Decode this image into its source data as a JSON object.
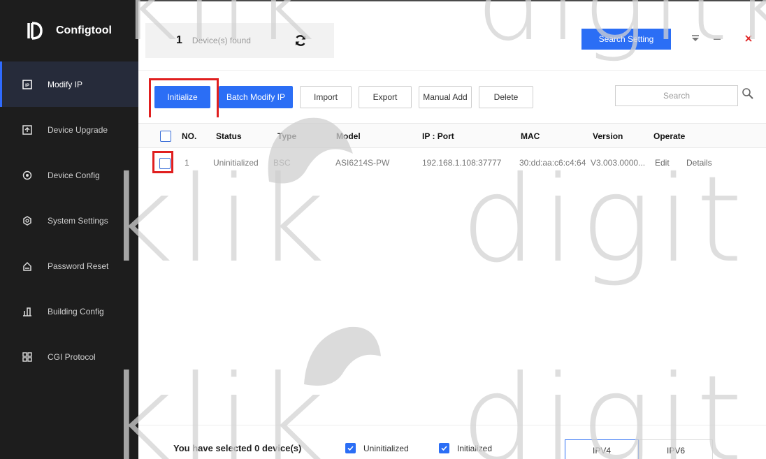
{
  "app": {
    "name": "Configtool"
  },
  "sidebar": {
    "items": [
      {
        "label": "Modify IP",
        "icon": "ip-icon",
        "active": true
      },
      {
        "label": "Device Upgrade",
        "icon": "upgrade-icon",
        "active": false
      },
      {
        "label": "Device Config",
        "icon": "config-icon",
        "active": false
      },
      {
        "label": "System Settings",
        "icon": "settings-icon",
        "active": false
      },
      {
        "label": "Password Reset",
        "icon": "lock-icon",
        "active": false
      },
      {
        "label": "Building Config",
        "icon": "building-icon",
        "active": false
      },
      {
        "label": "CGI Protocol",
        "icon": "protocol-icon",
        "active": false
      }
    ]
  },
  "header": {
    "device_count": "1",
    "found_label": "Device(s) found",
    "search_setting_label": "Search Setting"
  },
  "toolbar": {
    "initialize": "Initialize",
    "batch_modify": "Batch Modify IP",
    "import": "Import",
    "export": "Export",
    "manual_add": "Manual Add",
    "delete": "Delete",
    "search_placeholder": "Search"
  },
  "table": {
    "columns": [
      "NO.",
      "Status",
      "Type",
      "Model",
      "IP : Port",
      "MAC",
      "Version",
      "Operate"
    ],
    "rows": [
      {
        "no": "1",
        "status": "Uninitialized",
        "type": "BSC",
        "model": "ASI6214S-PW",
        "ip_port": "192.168.1.108:37777",
        "mac": "30:dd:aa:c6:c4:64",
        "version": "V3.003.0000...",
        "edit": "Edit",
        "details": "Details"
      }
    ]
  },
  "footer": {
    "selected_prefix": "You have selected",
    "selected_count": "0",
    "selected_suffix": "device(s)",
    "filter_uninitialized": "Uninitialized",
    "filter_initialized": "Initialized",
    "ipv4": "IPV4",
    "ipv6": "IPV6"
  },
  "watermark": {
    "text": "klik digitkli"
  },
  "colors": {
    "accent": "#2b6ef5",
    "sidebar": "#1d1d1d",
    "highlight": "#e01f1f"
  }
}
